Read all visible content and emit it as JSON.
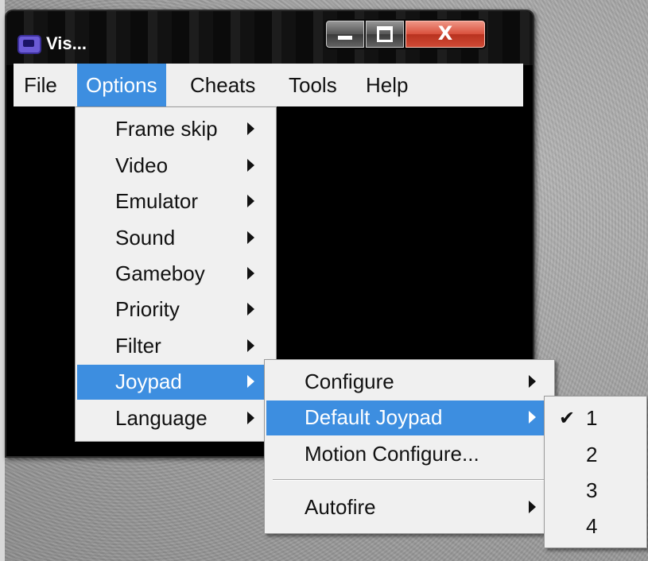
{
  "window": {
    "title": "Vis...",
    "icon": "app-icon",
    "close_label": "X"
  },
  "menubar": {
    "items": [
      "File",
      "Options",
      "Cheats",
      "Tools",
      "Help"
    ],
    "active": "Options"
  },
  "options_menu": {
    "items": [
      {
        "label": "Frame skip",
        "submenu": true
      },
      {
        "label": "Video",
        "submenu": true
      },
      {
        "label": "Emulator",
        "submenu": true
      },
      {
        "label": "Sound",
        "submenu": true
      },
      {
        "label": "Gameboy",
        "submenu": true
      },
      {
        "label": "Priority",
        "submenu": true
      },
      {
        "label": "Filter",
        "submenu": true
      },
      {
        "label": "Joypad",
        "submenu": true,
        "highlighted": true
      },
      {
        "label": "Language",
        "submenu": true
      }
    ]
  },
  "joypad_menu": {
    "items": [
      {
        "label": "Configure",
        "submenu": true
      },
      {
        "label": "Default Joypad",
        "submenu": true,
        "highlighted": true
      },
      {
        "label": "Motion Configure...",
        "submenu": false
      },
      {
        "label": "Autofire",
        "submenu": true
      }
    ]
  },
  "default_joypad_menu": {
    "items": [
      "1",
      "2",
      "3",
      "4"
    ],
    "checked": "1",
    "check_glyph": "✔"
  },
  "colors": {
    "highlight": "#3d8ee0",
    "menu_bg": "#f0f0f0",
    "window_bg": "#000000"
  }
}
